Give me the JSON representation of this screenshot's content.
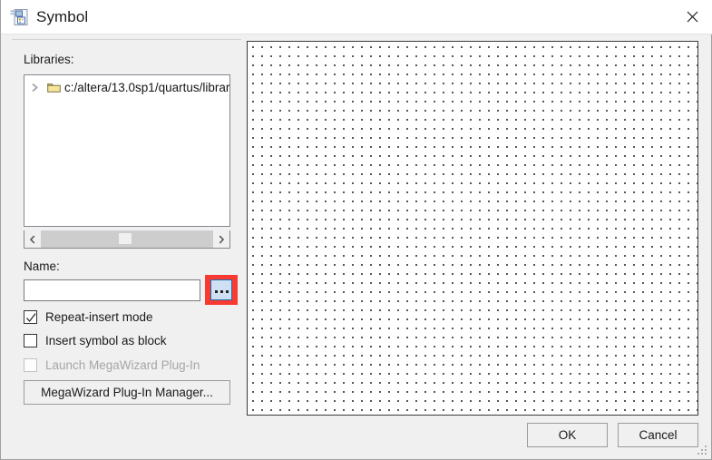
{
  "window": {
    "title": "Symbol",
    "icon": "symbol-document-icon",
    "close_label": "✕"
  },
  "left_panel": {
    "libraries_label": "Libraries:",
    "tree": {
      "items": [
        {
          "label": "c:/altera/13.0sp1/quartus/librar",
          "expander": "chevron-right-icon",
          "icon": "folder-icon",
          "expanded": false
        }
      ]
    },
    "scrollbar": {
      "left_arrow": "‹",
      "right_arrow": "›"
    },
    "name_label": "Name:",
    "name_input": {
      "value": "",
      "placeholder": ""
    },
    "browse_button": {
      "label": "...",
      "highlighted": true,
      "highlight_color": "#f83a33"
    },
    "checkboxes": [
      {
        "label": "Repeat-insert mode",
        "checked": true,
        "disabled": false
      },
      {
        "label": "Insert symbol as block",
        "checked": false,
        "disabled": false
      },
      {
        "label": "Launch MegaWizard Plug-In",
        "checked": false,
        "disabled": true
      }
    ],
    "megawizard_button": "MegaWizard Plug-In Manager..."
  },
  "preview": {
    "name": "symbol-preview-canvas",
    "grid_spacing_px": 10,
    "background": "#ffffff",
    "dot_color": "#2b2b2b"
  },
  "footer": {
    "ok_label": "OK",
    "cancel_label": "Cancel"
  }
}
